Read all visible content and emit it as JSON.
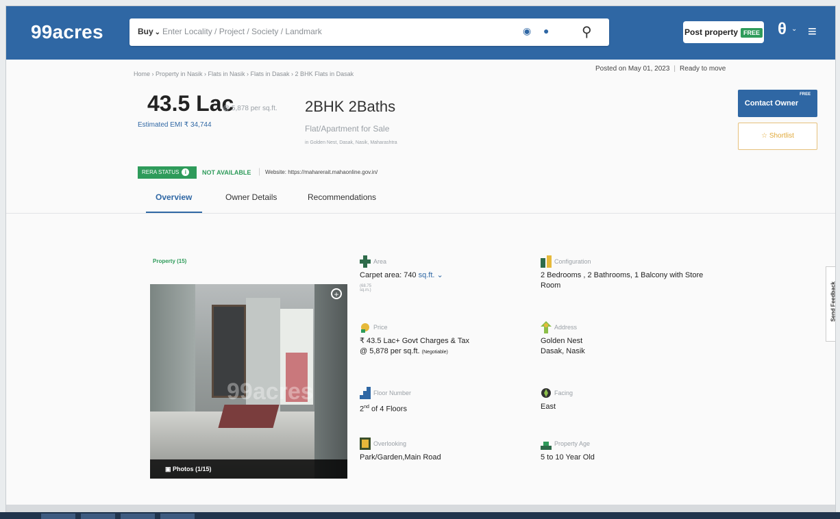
{
  "header": {
    "logo": "99acres",
    "search": {
      "mode": "Buy",
      "placeholder": "Enter Locality / Project / Society / Landmark"
    },
    "post_property": {
      "label": "Post property",
      "badge": "FREE"
    }
  },
  "breadcrumb": "Home › Property in Nasik › Flats in Nasik › Flats in Dasak › 2 BHK Flats in Dasak",
  "posted": {
    "date": "Posted on May 01, 2023",
    "status": "Ready to move"
  },
  "listing": {
    "price": "43.5 Lac",
    "rate": "@ 5,878 per sq.ft.",
    "emi": "Estimated EMI ₹ 34,744",
    "config_title": "2BHK 2Baths",
    "sale_type": "Flat/Apartment for Sale",
    "location": "in Golden Nest, Dasak, Nasik, Maharashtra"
  },
  "rera": {
    "label": "RERA STATUS",
    "value": "NOT AVAILABLE",
    "website": "Website: https://maharerait.mahaonline.gov.in/"
  },
  "tabs": [
    {
      "label": "Overview"
    },
    {
      "label": "Owner Details"
    },
    {
      "label": "Recommendations"
    }
  ],
  "actions": {
    "contact": "Contact Owner",
    "contact_badge": "FREE",
    "shortlist": "Shortlist"
  },
  "feedback": "Send Feedback",
  "gallery": {
    "title": "Property (15)",
    "photos_label": "Photos (1/15)",
    "watermark": "99acres"
  },
  "details": {
    "area": {
      "label": "Area",
      "value": "Carpet area: 740",
      "unit": "sq.ft.",
      "sub": "(68.75 sq.m.)"
    },
    "configuration": {
      "label": "Configuration",
      "line1": "2 Bedrooms , 2 Bathrooms, 1 Balcony with Store",
      "line2": "Room"
    },
    "price": {
      "label": "Price",
      "line1": "₹ 43.5 Lac+ Govt Charges & Tax",
      "line2": "@ 5,878 per sq.ft.",
      "note": "(Negotiable)"
    },
    "address": {
      "label": "Address",
      "line1": "Golden Nest",
      "line2": "Dasak, Nasik"
    },
    "floor": {
      "label": "Floor Number",
      "floor": "2",
      "suffix": "nd",
      "rest": " of 4 Floors"
    },
    "facing": {
      "label": "Facing",
      "value": "East"
    },
    "overlooking": {
      "label": "Overlooking",
      "value": "Park/Garden,Main Road"
    },
    "age": {
      "label": "Property Age",
      "value": "5 to 10 Year Old"
    }
  },
  "colors": {
    "brand_blue": "#2f67a4",
    "green": "#2e9b5a",
    "gold": "#e0a93a"
  }
}
